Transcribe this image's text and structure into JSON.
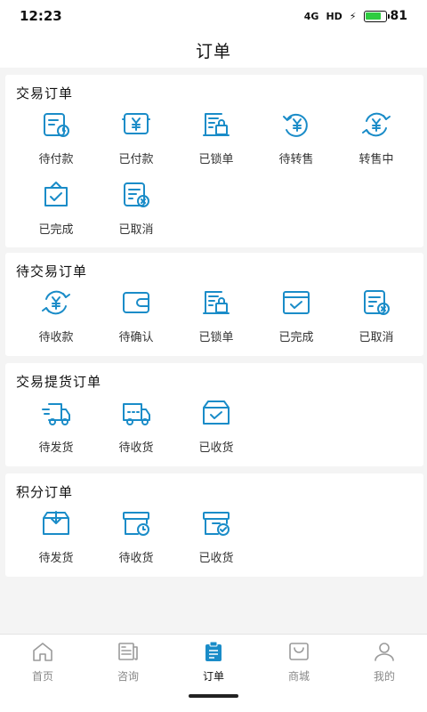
{
  "status": {
    "time": "12:23",
    "signal": "4G",
    "hd": "HD",
    "battery": "81",
    "battery_level": 0.81,
    "battery_color": "#2ecc40"
  },
  "header": {
    "title": "订单"
  },
  "accent": "#1a8cc8",
  "sections": [
    {
      "title": "交易订单",
      "items": [
        {
          "label": "待付款",
          "icon": "pending-payment-icon"
        },
        {
          "label": "已付款",
          "icon": "paid-icon"
        },
        {
          "label": "已锁单",
          "icon": "locked-order-icon"
        },
        {
          "label": "待转售",
          "icon": "pending-resale-icon"
        },
        {
          "label": "转售中",
          "icon": "reselling-icon"
        },
        {
          "label": "已完成",
          "icon": "completed-bag-icon"
        },
        {
          "label": "已取消",
          "icon": "cancelled-icon"
        }
      ]
    },
    {
      "title": "待交易订单",
      "items": [
        {
          "label": "待收款",
          "icon": "pending-receipt-icon"
        },
        {
          "label": "待确认",
          "icon": "wallet-icon"
        },
        {
          "label": "已锁单",
          "icon": "locked-order-icon"
        },
        {
          "label": "已完成",
          "icon": "completed-icon"
        },
        {
          "label": "已取消",
          "icon": "cancelled-icon"
        }
      ]
    },
    {
      "title": "交易提货订单",
      "items": [
        {
          "label": "待发货",
          "icon": "truck-fast-icon"
        },
        {
          "label": "待收货",
          "icon": "truck-icon"
        },
        {
          "label": "已收货",
          "icon": "box-check-icon"
        }
      ]
    },
    {
      "title": "积分订单",
      "items": [
        {
          "label": "待发货",
          "icon": "box-download-icon"
        },
        {
          "label": "待收货",
          "icon": "box-clock-icon"
        },
        {
          "label": "已收货",
          "icon": "box-done-icon"
        }
      ]
    }
  ],
  "tabbar": {
    "active_color": "#1a8cc8",
    "tabs": [
      {
        "label": "首页",
        "icon": "home-icon",
        "active": false
      },
      {
        "label": "咨询",
        "icon": "news-icon",
        "active": false
      },
      {
        "label": "订单",
        "icon": "orders-icon",
        "active": true
      },
      {
        "label": "商城",
        "icon": "shop-icon",
        "active": false
      },
      {
        "label": "我的",
        "icon": "user-icon",
        "active": false
      }
    ]
  }
}
